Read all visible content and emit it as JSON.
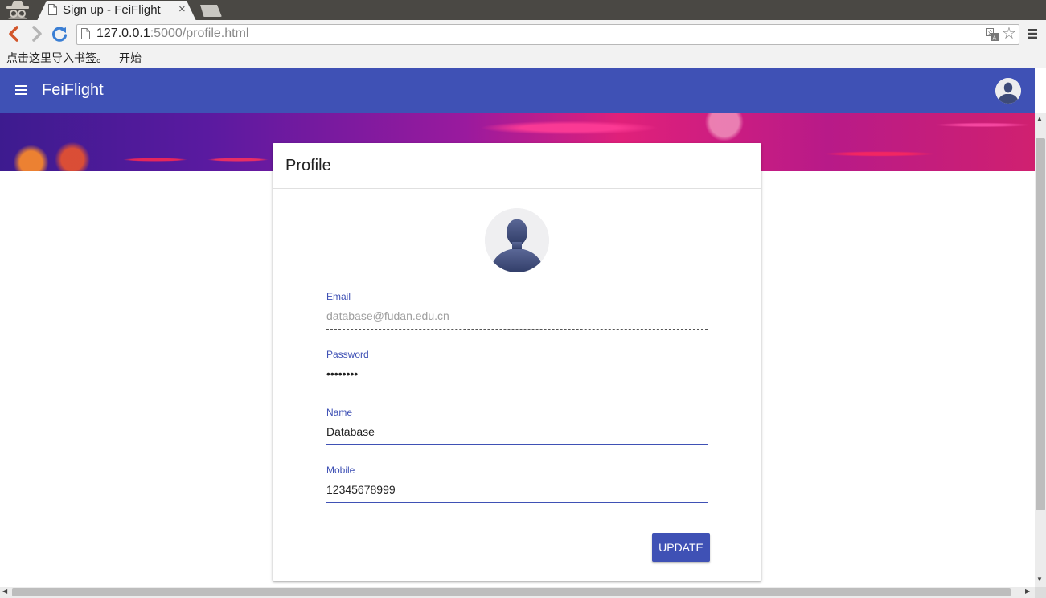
{
  "browser": {
    "tab_title": "Sign up - FeiFlight",
    "tab_close": "×",
    "url_host": "127.0.0.1",
    "url_rest": ":5000/profile.html",
    "bookmarks_prompt": "点击这里导入书签。",
    "bookmarks_link": "开始",
    "star_glyph": "☆"
  },
  "app": {
    "title": "FeiFlight",
    "brand_color": "#3f51b5"
  },
  "card": {
    "title": "Profile",
    "fields": [
      {
        "label": "Email",
        "value": "database@fudan.edu.cn",
        "disabled": true
      },
      {
        "label": "Password",
        "value": "••••••••",
        "type": "password"
      },
      {
        "label": "Name",
        "value": "Database"
      },
      {
        "label": "Mobile",
        "value": "12345678999"
      }
    ],
    "update_label": "UPDATE"
  },
  "scrollbars": {
    "up": "▲",
    "down": "▼",
    "left": "◀",
    "right": "▶"
  }
}
